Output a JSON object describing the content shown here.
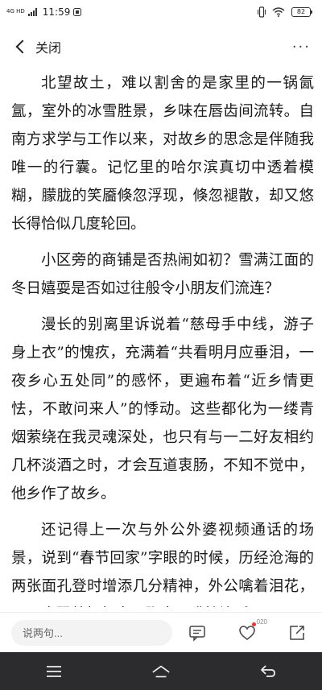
{
  "status_bar": {
    "signal_text": "4G HD",
    "time": "11:59",
    "battery": "82"
  },
  "nav": {
    "title": "关闭",
    "more": "···"
  },
  "article": {
    "paragraphs": [
      "北望故土，难以割舍的是家里的一锅氤氲，室外的冰雪胜景，乡味在唇齿间流转。自南方求学与工作以来，对故乡的思念是伴随我唯一的行囊。记忆里的哈尔滨真切中透着模糊，朦胧的笑靥倏忽浮现，倏忽褪散，却又悠长得恰似几度轮回。",
      "小区旁的商铺是否热闹如初？雪满江面的冬日嬉耍是否如过往般令小朋友们流连？",
      "漫长的别离里诉说着“慈母手中线，游子身上衣”的愧疚，充满着“共看明月应垂泪，一夜乡心五处同”的感怀，更遍布着“近乡情更怯，不敢问来人”的悸动。这些都化为一缕青烟萦绕在我灵魂深处，也只有与一二好友相约几杯淡酒之时，才会互道衷肠，不知不觉中，他乡作了故乡。",
      "还记得上一次与外公外婆视频通话的场景，说到“春节回家”字眼的时候，历经沧海的两张面孔登时增添几分精神，外公噙着泪花，双眉也跟着舞起来，张大了嘴接连乐"
    ]
  },
  "comment_bar": {
    "placeholder": "说两句...",
    "like_count": "020"
  },
  "colors": {
    "like_dot": "#e33333",
    "sys_nav_bg": "#2c2c2e"
  }
}
